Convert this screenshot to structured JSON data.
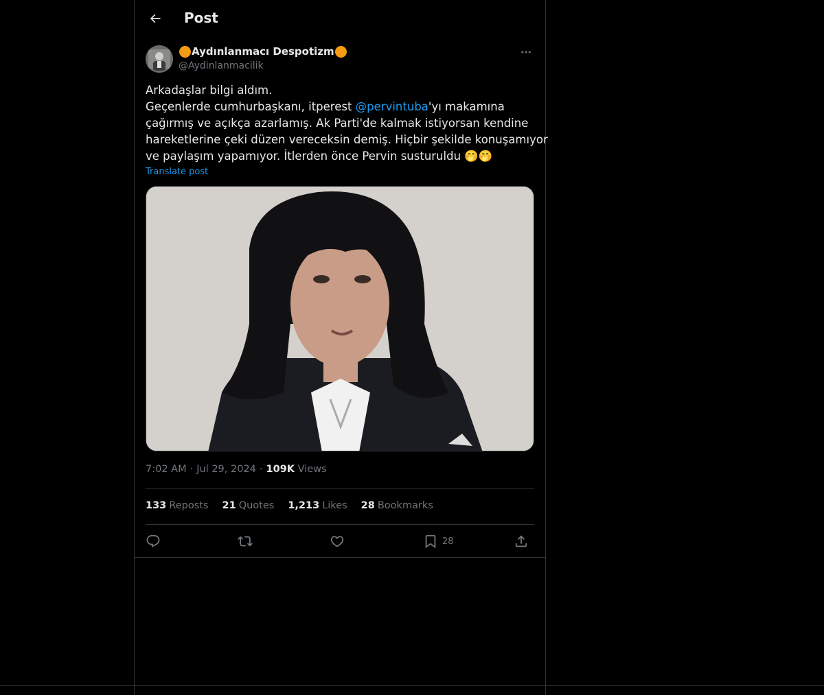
{
  "header": {
    "title": "Post"
  },
  "author": {
    "display_name": "Aydınlanmacı Despotizm",
    "handle": "@Aydinlanmacilik"
  },
  "tweet": {
    "line1": "Arkadaşlar bilgi aldım.",
    "line2_pre": "Geçenlerde cumhurbaşkanı, itperest ",
    "mention": "@pervintuba",
    "line2_post": "'yı makamına",
    "line3": "çağırmış ve açıkça azarlamış. Ak Parti'de kalmak istiyorsan kendine",
    "line4": "hareketlerine çeki düzen vereceksin demiş. Hiçbir şekilde konuşamıyor",
    "line5": "ve paylaşım yapamıyor. İtlerden önce Pervin susturuldu 🤭🤭",
    "translate": "Translate post"
  },
  "meta": {
    "time": "7:02 AM",
    "date": "Jul 29, 2024",
    "separator": "·",
    "views_count": "109K",
    "views_label": "Views"
  },
  "stats": {
    "reposts_count": "133",
    "reposts_label": "Reposts",
    "quotes_count": "21",
    "quotes_label": "Quotes",
    "likes_count": "1,213",
    "likes_label": "Likes",
    "bookmarks_count": "28",
    "bookmarks_label": "Bookmarks"
  },
  "actions": {
    "bookmark_count": "28"
  },
  "colors": {
    "accent": "#1d9bf0",
    "muted": "#71767b",
    "text": "#e7e9ea",
    "border": "#2f3336",
    "badge": "#f59b14"
  }
}
